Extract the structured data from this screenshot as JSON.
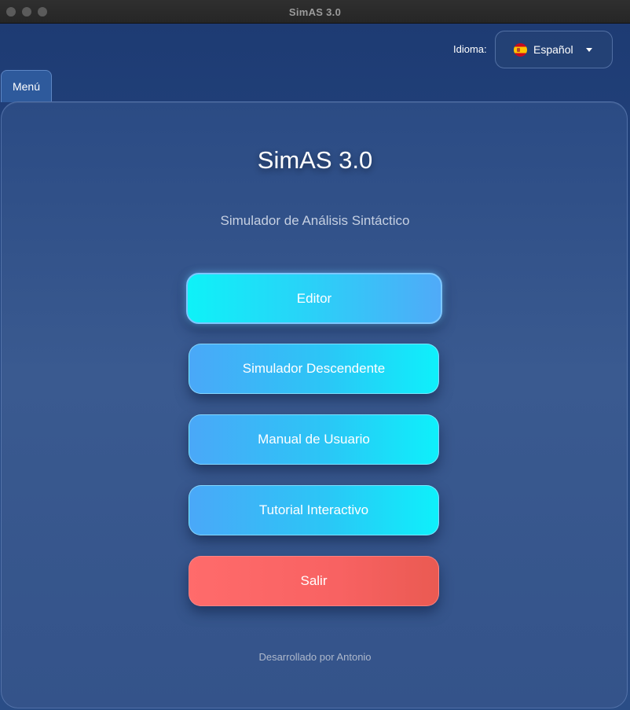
{
  "window": {
    "title": "SimAS 3.0"
  },
  "header": {
    "language_label": "Idioma:",
    "language_selected": "Español",
    "language_flag_icon": "spain-flag-icon",
    "dropdown_icon": "caret-down-icon"
  },
  "tabs": [
    {
      "label": "Menú",
      "active": true
    }
  ],
  "main": {
    "title": "SimAS 3.0",
    "subtitle": "Simulador de Análisis Sintáctico",
    "buttons": {
      "editor": "Editor",
      "descendente": "Simulador Descendente",
      "manual": "Manual de Usuario",
      "tutorial": "Tutorial Interactivo",
      "exit": "Salir"
    },
    "footer": "Desarrollado por Antonio"
  },
  "colors": {
    "accent_cyan": "#0ef0fb",
    "accent_blue": "#4aa8f8",
    "exit_red": "#f86262",
    "background": "#1f3a6e"
  }
}
